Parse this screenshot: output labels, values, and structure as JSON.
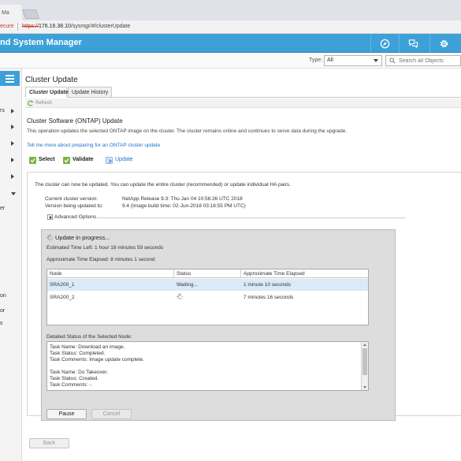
{
  "browser": {
    "tab_title": "Ma",
    "secure_label": "ecure",
    "url_scheme": "https://",
    "url_host": "176.16.38.10",
    "url_path": "/sysmgr/#/clusterUpdate"
  },
  "header": {
    "title": "nd System Manager",
    "icons": [
      "compass-icon",
      "chat-icon",
      "gear-icon"
    ],
    "accent_color": "#3da0d8"
  },
  "toolbar": {
    "type_label": "Type:",
    "type_value": "All",
    "search_placeholder": "Search all Objects"
  },
  "sidebar": {
    "items": [
      {
        "label": "rs",
        "arrow": "right"
      },
      {
        "label": "",
        "arrow": "right"
      },
      {
        "label": "",
        "arrow": "right"
      },
      {
        "label": "",
        "arrow": "right"
      },
      {
        "label": "",
        "arrow": "right"
      },
      {
        "label": "",
        "arrow": "down"
      },
      {
        "label": "er",
        "arrow": ""
      },
      {
        "label": "on",
        "arrow": ""
      },
      {
        "label": "or",
        "arrow": ""
      },
      {
        "label": "s",
        "arrow": ""
      }
    ]
  },
  "page": {
    "title": "Cluster Update",
    "tabs": [
      {
        "label": "Cluster Update",
        "active": true
      },
      {
        "label": "Update History",
        "active": false
      }
    ],
    "refresh_label": "Refresh",
    "section_title": "Cluster Software (ONTAP) Update",
    "section_desc": "This operation updates the selected ONTAP image on the cluster. The cluster remains online and continues to serve data during the upgrade.",
    "learn_link": "Tell me more about preparing for an ONTAP cluster update",
    "steps": [
      {
        "label": "Select",
        "state": "done"
      },
      {
        "label": "Validate",
        "state": "done"
      },
      {
        "label": "Update",
        "state": "current"
      }
    ]
  },
  "update": {
    "can_update_text": "The cluster can now be updated. You can update the entire cluster (recommended) or update individual HA pairs.",
    "current_version_label": "Current cluster version:",
    "current_version_value": "NetApp Release 9.3: Thu Jan 04 10:56:26 UTC 2018",
    "target_version_label": "Version being updated to:",
    "target_version_value": "9.4 (Image build time: 02-Jun-2018 03:18:55 PM UTC)",
    "advanced_options": "Advanced Options"
  },
  "progress": {
    "title": "Update in progress...",
    "time_left": "Estimated Time Left:  1 hour 18 minutes 59 seconds",
    "time_elapsed": "Approximate Time Elapsed:  8 minutes 1 second",
    "columns": [
      "Node",
      "Status",
      "Approximate Time Elapsed"
    ],
    "rows": [
      {
        "node": "SRA200_1",
        "status": "Waiting...",
        "elapsed": "1 minute 10 seconds",
        "selected": true
      },
      {
        "node": "SRA200_2",
        "status": "",
        "elapsed": "7 minutes 16 seconds",
        "selected": false
      }
    ],
    "detail_label": "Detailed Status of the Selected Node:",
    "detail_lines": [
      "Task Name: Download an image.",
      "Task Status: Completed.",
      "Task Comments: Image update complete.",
      "",
      "Task Name: Do Takeover.",
      "Task Status: Created.",
      "Task Comments: -."
    ],
    "pause_label": "Pause",
    "cancel_label": "Cancel"
  },
  "footer": {
    "back_label": "Back"
  }
}
